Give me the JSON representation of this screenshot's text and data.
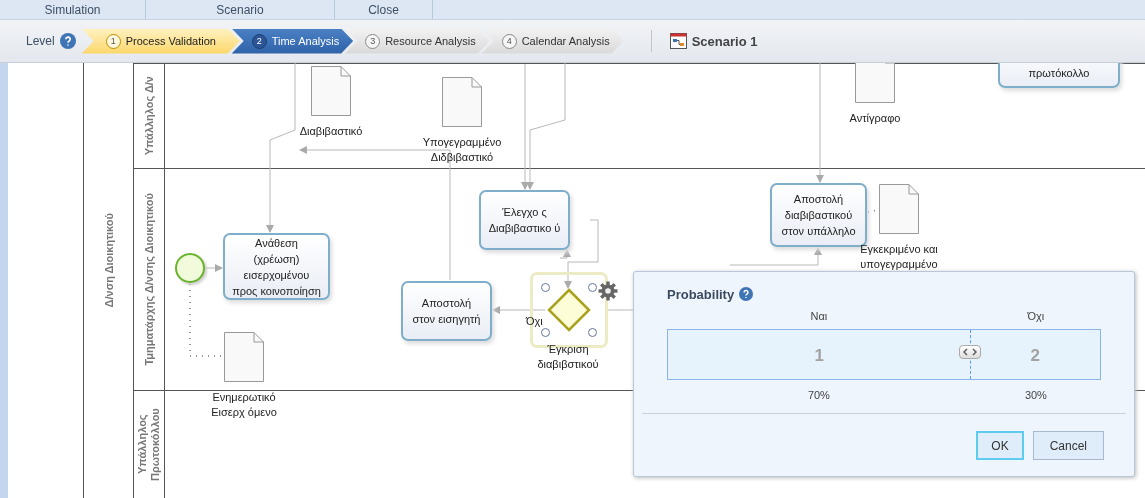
{
  "menu": [
    {
      "label": "Simulation"
    },
    {
      "label": "Scenario"
    },
    {
      "label": "Close"
    }
  ],
  "toolbar": {
    "level_label": "Level",
    "steps": [
      {
        "number": "1",
        "label": "Process Validation",
        "selected": false,
        "highlighted": true
      },
      {
        "number": "2",
        "label": "Time Analysis",
        "selected": true,
        "highlighted": false
      },
      {
        "number": "3",
        "label": "Resource Analysis",
        "selected": false,
        "highlighted": false
      },
      {
        "number": "4",
        "label": "Calendar Analysis",
        "selected": false,
        "highlighted": false
      }
    ],
    "scenario": "Scenario 1"
  },
  "pool": {
    "label": "Δ/νση Διοικητικού",
    "lanes": [
      {
        "label": "Υπάλληλος Δ/ν"
      },
      {
        "label": "Τμηματάρχης Δ/νσης Διοικητικού"
      },
      {
        "label": "Υπάλληλος Πρωτοκόλλου"
      }
    ]
  },
  "nodes": [
    {
      "kind": "document",
      "label": "Διαβιβαστικό"
    },
    {
      "kind": "document",
      "label": "Υπογεγραμμένο Διδβιβαστικό"
    },
    {
      "kind": "document",
      "label": "Αντίγραφο"
    },
    {
      "kind": "task",
      "label": "πρωτόκολλο"
    },
    {
      "kind": "task",
      "label": "Έλεγχο ς Διαβιβαστικο ύ"
    },
    {
      "kind": "task",
      "label": "Αποστολή διαβιβαστικού στον υπάλληλο"
    },
    {
      "kind": "document",
      "label": "Εγκεκριμένο και υπογεγραμμένο"
    },
    {
      "kind": "start"
    },
    {
      "kind": "task",
      "label": "Ανάθεση (χρέωση) εισερχομένου προς κοινοποίηση"
    },
    {
      "kind": "task",
      "label": "Αποστολή στον εισηγητή"
    },
    {
      "kind": "gateway",
      "label": "Έγκριση διαβιβστικού",
      "selected": true
    },
    {
      "kind": "flow_label",
      "label": "Όχι"
    },
    {
      "kind": "document",
      "label": "Ενημερωτικό Εισερχ όμενο"
    }
  ],
  "dialog": {
    "title": "Probability",
    "branches": [
      {
        "label": "Ναι",
        "number": "1",
        "percent": "70%"
      },
      {
        "label": "Όχι",
        "number": "2",
        "percent": "30%"
      }
    ],
    "slider": {
      "level": 0.7
    },
    "buttons": [
      {
        "label": "OK",
        "default": true
      },
      {
        "label": "Cancel",
        "default": false
      }
    ]
  }
}
